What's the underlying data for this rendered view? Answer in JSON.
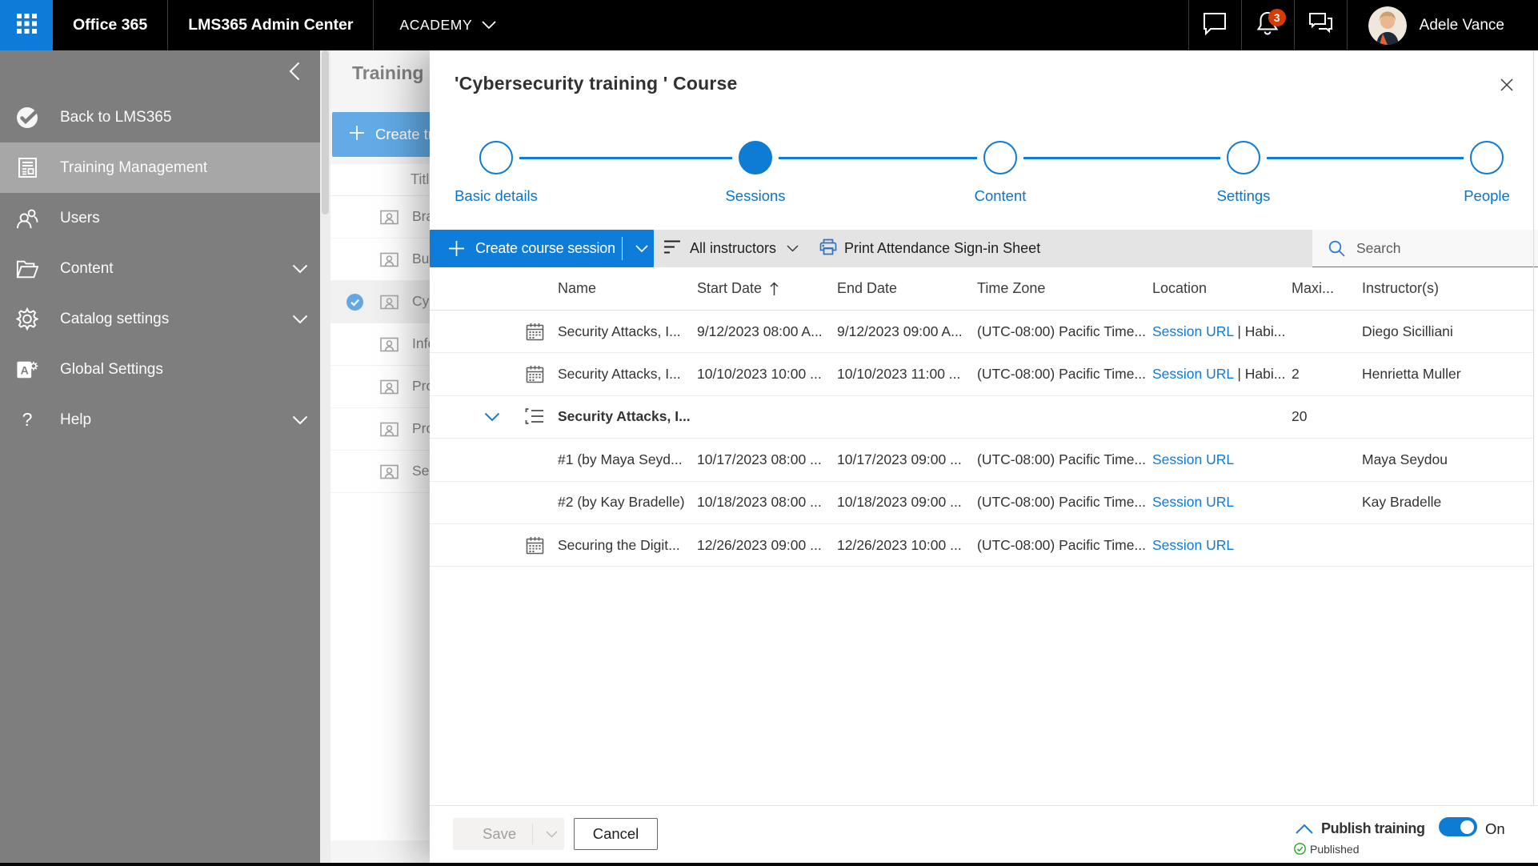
{
  "accent": "#0e7cd4",
  "topbar": {
    "office_label": "Office 365",
    "admin_center_label": "LMS365 Admin Center",
    "tenant": "ACADEMY",
    "notification_count": "3",
    "user_name": "Adele Vance"
  },
  "sidebar": {
    "items": [
      {
        "label": "Back to LMS365"
      },
      {
        "label": "Training Management"
      },
      {
        "label": "Users"
      },
      {
        "label": "Content"
      },
      {
        "label": "Catalog settings"
      },
      {
        "label": "Global Settings"
      },
      {
        "label": "Help"
      }
    ]
  },
  "page_behind": {
    "title": "Training Management",
    "create_button": "Create training plan",
    "column_title": "Title",
    "rows": [
      {
        "label": "Brand new courses"
      },
      {
        "label": "Business plans"
      },
      {
        "label": "Cybersecurity training"
      },
      {
        "label": "Information"
      },
      {
        "label": "Product training"
      },
      {
        "label": "Project management"
      },
      {
        "label": "Security courses"
      }
    ]
  },
  "modal": {
    "title": "'Cybersecurity training ' Course",
    "stepper": [
      {
        "label": "Basic details",
        "state": "upcoming"
      },
      {
        "label": "Sessions",
        "state": "active"
      },
      {
        "label": "Content",
        "state": "upcoming"
      },
      {
        "label": "Settings",
        "state": "upcoming"
      },
      {
        "label": "People",
        "state": "upcoming"
      }
    ],
    "toolbar": {
      "create_session": "Create course session",
      "filter": "All instructors",
      "print": "Print Attendance Sign-in Sheet",
      "search_placeholder": "Search"
    },
    "table": {
      "headers": {
        "name": "Name",
        "start": "Start Date",
        "end": "End Date",
        "timezone": "Time Zone",
        "location": "Location",
        "max": "Maxi...",
        "instructors": "Instructor(s)"
      },
      "rows": [
        {
          "name": "Security Attacks, I...",
          "start": "9/12/2023 08:00 A...",
          "end": "9/12/2023 09:00 A...",
          "timezone": "(UTC-08:00) Pacific Time...",
          "location_link": "Session URL",
          "location_suffix": " | Habi...",
          "max": "",
          "instructors": "Diego Sicilliani"
        },
        {
          "name": "Security Attacks, I...",
          "start": "10/10/2023 10:00 ...",
          "end": "10/10/2023 11:00 ...",
          "timezone": "(UTC-08:00) Pacific Time...",
          "location_link": "Session URL",
          "location_suffix": " | Habi...",
          "max": "2",
          "instructors": "Henrietta Muller"
        },
        {
          "name": "Security Attacks, I...",
          "start": "",
          "end": "",
          "timezone": "",
          "max": "20",
          "instructors": ""
        },
        {
          "name": "#1 (by Maya Seyd...",
          "start": "10/17/2023 08:00 ...",
          "end": "10/17/2023 09:00 ...",
          "timezone": "(UTC-08:00) Pacific Time...",
          "location_link": "Session URL",
          "max": "",
          "instructors": "Maya Seydou"
        },
        {
          "name": "#2 (by Kay Bradelle)",
          "start": "10/18/2023 08:00 ...",
          "end": "10/18/2023 09:00 ...",
          "timezone": "(UTC-08:00) Pacific Time...",
          "location_link": "Session URL",
          "max": "",
          "instructors": "Kay Bradelle"
        },
        {
          "name": "Securing the Digit...",
          "start": "12/26/2023 09:00 ...",
          "end": "12/26/2023 10:00 ...",
          "timezone": "(UTC-08:00) Pacific Time...",
          "location_link": "Session URL",
          "max": "",
          "instructors": ""
        }
      ]
    },
    "footer": {
      "save": "Save",
      "cancel": "Cancel",
      "publish": "Publish training",
      "toggle_state": "On",
      "status": "Published"
    }
  },
  "icons": {
    "app-launcher": "waffle",
    "chat": "speech-bubble",
    "notifications": "bell",
    "feedback": "double-bubble",
    "search": "magnifier",
    "print": "printer",
    "filter": "lines",
    "calendar": "calendar",
    "session-group": "list",
    "published": "check-circle-green"
  }
}
